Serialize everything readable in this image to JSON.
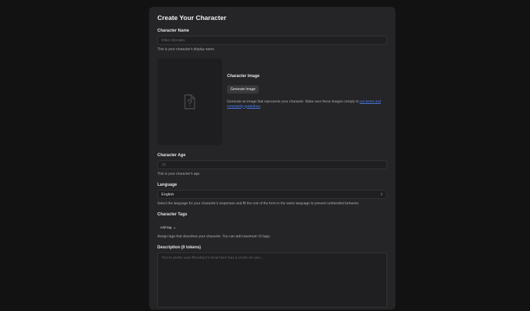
{
  "form": {
    "title": "Create Your Character",
    "name": {
      "label": "Character Name",
      "placeholder": "Miles Morales",
      "help": "This is your character's display name."
    },
    "image": {
      "label": "Character Image",
      "button": "Generate Image",
      "help_prefix": "Generate an image that represents your character. Make sure these images comply to ",
      "help_link": "our terms and community guidelines",
      "help_suffix": ".",
      "placeholder_icon": "image-file-question-icon"
    },
    "age": {
      "label": "Character Age",
      "placeholder": "18",
      "help": "This is your character's age."
    },
    "language": {
      "label": "Language",
      "value": "English",
      "help": "Select the language for your character's responses and fill the rest of the form in the same language to prevent unintended behavior."
    },
    "tags": {
      "label": "Character Tags",
      "add_label": "Add tag",
      "add_icon": "plus-icon",
      "help": "Assign tags that describes your character. You can add maximum 10 tags."
    },
    "description": {
      "label": "Description (0 tokens)",
      "placeholder": "You're pretty sure Brooklyn's local hero has a crush on you..."
    }
  }
}
